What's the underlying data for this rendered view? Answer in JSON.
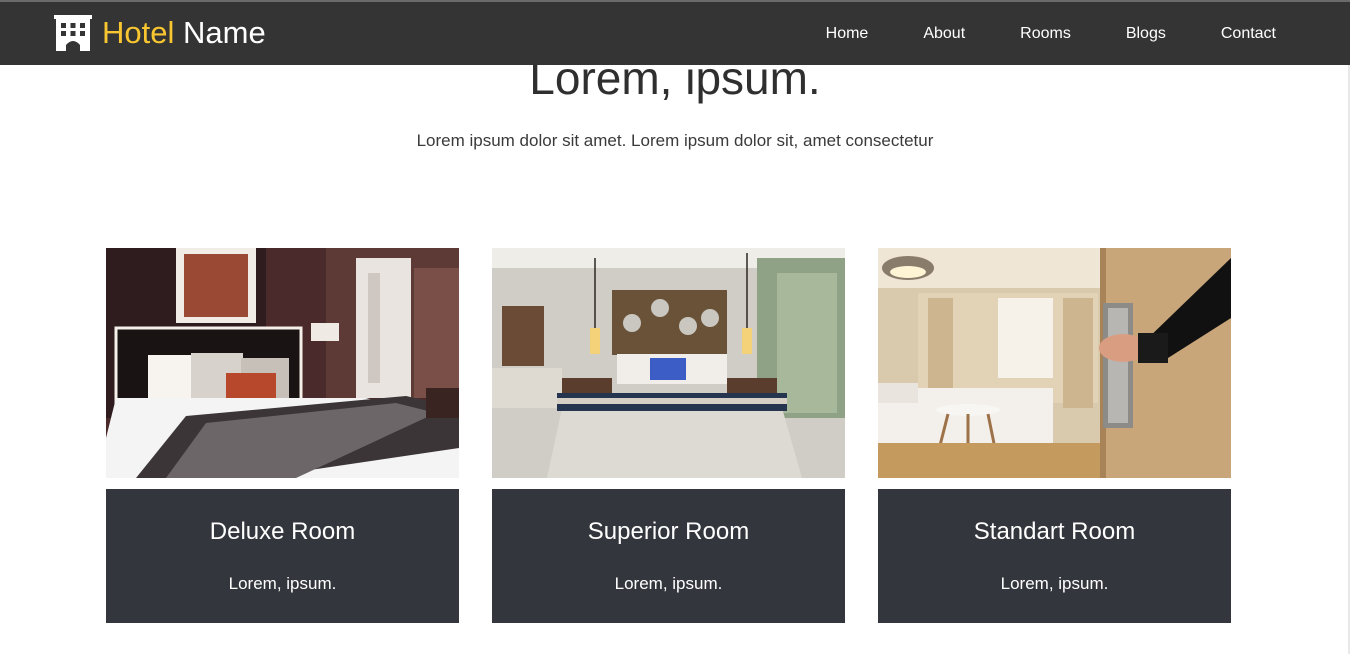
{
  "navbar": {
    "brand": {
      "highlight": "Hotel",
      "rest": "Name",
      "icon": "hotel-building-icon"
    },
    "links": [
      "Home",
      "About",
      "Rooms",
      "Blogs",
      "Contact"
    ]
  },
  "hero": {
    "title": "Lorem, ipsum.",
    "subtitle": "Lorem ipsum dolor sit amet. Lorem ipsum dolor sit, amet consectetur"
  },
  "rooms": [
    {
      "title": "Deluxe Room",
      "text": "Lorem, ipsum."
    },
    {
      "title": "Superior Room",
      "text": "Lorem, ipsum."
    },
    {
      "title": "Standart Room",
      "text": "Lorem, ipsum."
    }
  ],
  "colors": {
    "navbar_bg": "#343434",
    "brand_accent": "#f8c630",
    "card_bg": "#33363c",
    "text_dark": "#2f2f2f"
  }
}
